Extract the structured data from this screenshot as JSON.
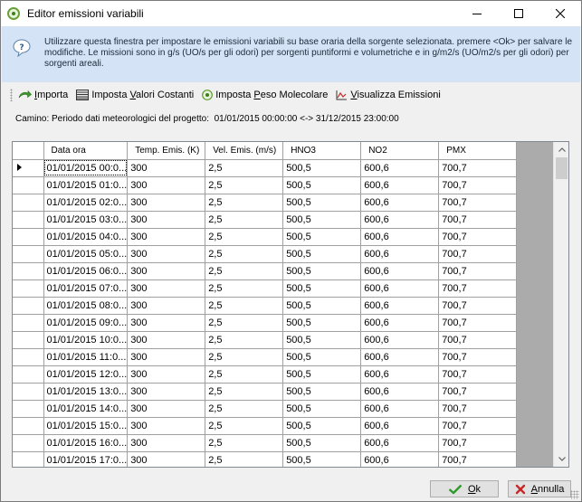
{
  "window": {
    "title": "Editor emissioni variabili"
  },
  "banner": {
    "text": "Utilizzare questa finestra per impostare le emissioni variabili su base oraria della sorgente selezionata. premere <Ok> per salvare le modifiche. Le missioni sono in g/s (UO/s per gli odori) per sorgenti puntiformi e volumetriche e in g/m2/s (UO/m2/s per gli odori) per sorgenti areali."
  },
  "toolbar": {
    "importa": {
      "pre": "",
      "key": "I",
      "post": "mporta"
    },
    "valori_costanti": {
      "pre": "Imposta ",
      "key": "V",
      "post": "alori Costanti"
    },
    "peso_molecolare": {
      "pre": "Imposta ",
      "key": "P",
      "post": "eso Molecolare"
    },
    "visualizza": {
      "pre": "",
      "key": "V",
      "post": "isualizza Emissioni"
    }
  },
  "period": {
    "label": "Camino: Periodo dati meteorologici del progetto:",
    "range": "01/01/2015 00:00:00 <-> 31/12/2015 23:00:00"
  },
  "grid": {
    "columns": [
      "Data ora",
      "Temp. Emis. (K)",
      "Vel. Emis. (m/s)",
      "HNO3",
      "NO2",
      "PMX"
    ],
    "rows": [
      [
        "01/01/2015 00:0...",
        "300",
        "2,5",
        "500,5",
        "600,6",
        "700,7"
      ],
      [
        "01/01/2015 01:0...",
        "300",
        "2,5",
        "500,5",
        "600,6",
        "700,7"
      ],
      [
        "01/01/2015 02:0...",
        "300",
        "2,5",
        "500,5",
        "600,6",
        "700,7"
      ],
      [
        "01/01/2015 03:0...",
        "300",
        "2,5",
        "500,5",
        "600,6",
        "700,7"
      ],
      [
        "01/01/2015 04:0...",
        "300",
        "2,5",
        "500,5",
        "600,6",
        "700,7"
      ],
      [
        "01/01/2015 05:0...",
        "300",
        "2,5",
        "500,5",
        "600,6",
        "700,7"
      ],
      [
        "01/01/2015 06:0...",
        "300",
        "2,5",
        "500,5",
        "600,6",
        "700,7"
      ],
      [
        "01/01/2015 07:0...",
        "300",
        "2,5",
        "500,5",
        "600,6",
        "700,7"
      ],
      [
        "01/01/2015 08:0...",
        "300",
        "2,5",
        "500,5",
        "600,6",
        "700,7"
      ],
      [
        "01/01/2015 09:0...",
        "300",
        "2,5",
        "500,5",
        "600,6",
        "700,7"
      ],
      [
        "01/01/2015 10:0...",
        "300",
        "2,5",
        "500,5",
        "600,6",
        "700,7"
      ],
      [
        "01/01/2015 11:0...",
        "300",
        "2,5",
        "500,5",
        "600,6",
        "700,7"
      ],
      [
        "01/01/2015 12:0...",
        "300",
        "2,5",
        "500,5",
        "600,6",
        "700,7"
      ],
      [
        "01/01/2015 13:0...",
        "300",
        "2,5",
        "500,5",
        "600,6",
        "700,7"
      ],
      [
        "01/01/2015 14:0...",
        "300",
        "2,5",
        "500,5",
        "600,6",
        "700,7"
      ],
      [
        "01/01/2015 15:0...",
        "300",
        "2,5",
        "500,5",
        "600,6",
        "700,7"
      ],
      [
        "01/01/2015 16:0...",
        "300",
        "2,5",
        "500,5",
        "600,6",
        "700,7"
      ],
      [
        "01/01/2015 17:0...",
        "300",
        "2,5",
        "500,5",
        "600,6",
        "700,7"
      ]
    ]
  },
  "buttons": {
    "ok": {
      "key": "O",
      "post": "k"
    },
    "cancel": {
      "key": "A",
      "post": "nnulla"
    }
  },
  "colors": {
    "banner_bg": "#d4e3f5",
    "accent_green": "#3a9a2a",
    "cancel_red": "#c62828"
  }
}
